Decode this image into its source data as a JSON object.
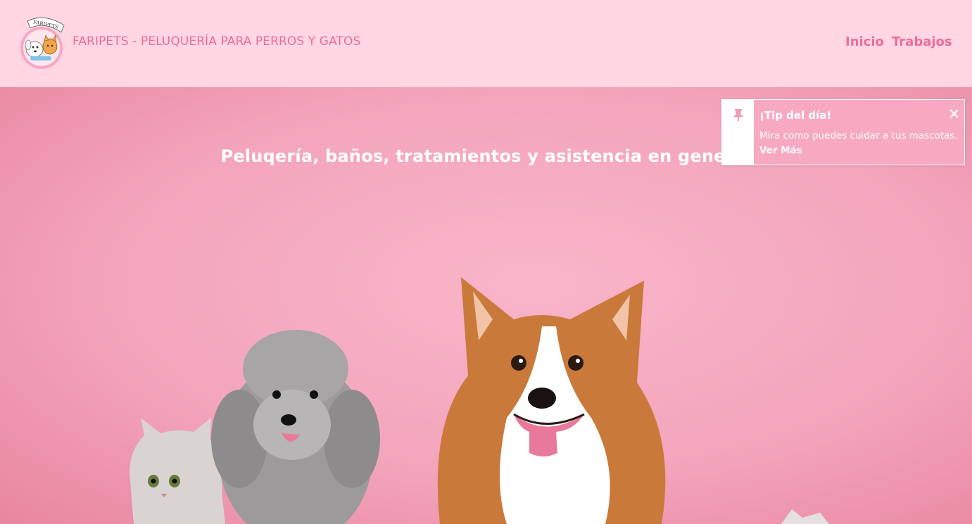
{
  "navbar": {
    "logo_text": "FARIPETS",
    "brand": "FARIPETS - PELUQUERÍA PARA PERROS Y GATOS",
    "links": [
      {
        "label": "Inicio"
      },
      {
        "label": "Trabajos"
      }
    ]
  },
  "hero": {
    "title": "Peluqería, baños, tratamientos y asistencia en general"
  },
  "toast": {
    "icon": "pin-icon",
    "title": "¡Tip del día!",
    "close": "×",
    "message": "Mira como puedes cuidar a tus mascotas.",
    "link": "Ver Más"
  },
  "colors": {
    "navbar_bg": "#ffd6e2",
    "accent": "#ec6c9c",
    "hero_bg": "#f3a5bc",
    "toast_bg": "#f8a9c2"
  }
}
